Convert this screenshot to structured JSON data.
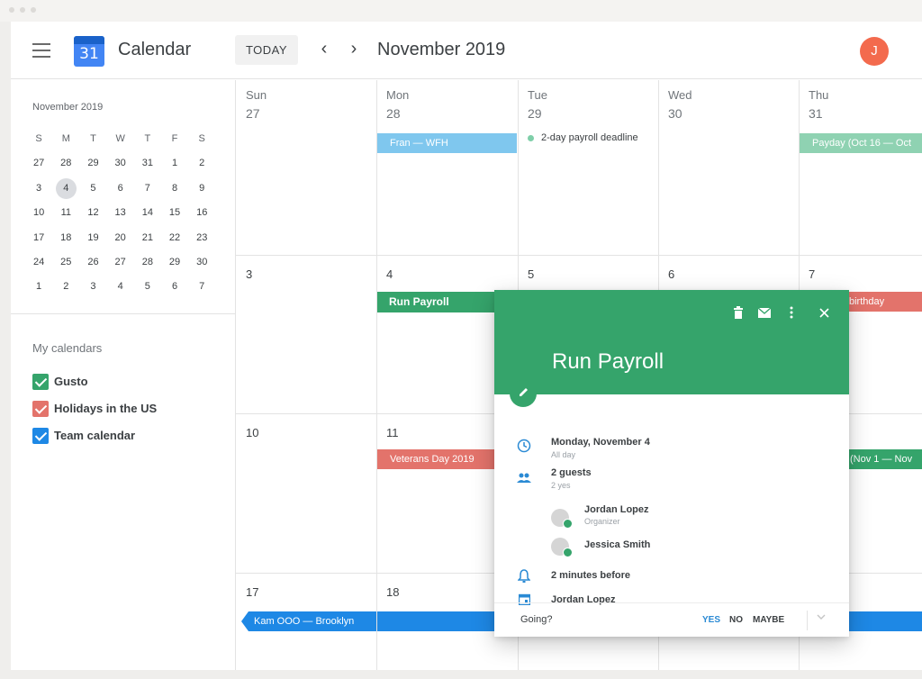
{
  "header": {
    "app_title": "Calendar",
    "logo_day": "31",
    "today_label": "TODAY",
    "prev_arrow": "‹",
    "next_arrow": "›",
    "month_title": "November 2019",
    "avatar_initial": "J",
    "avatar_color": "#f36a4d"
  },
  "mini_calendar": {
    "title": "November 2019",
    "weekdays": [
      "S",
      "M",
      "T",
      "W",
      "T",
      "F",
      "S"
    ],
    "weeks": [
      [
        "27",
        "28",
        "29",
        "30",
        "31",
        "1",
        "2"
      ],
      [
        "3",
        "4",
        "5",
        "6",
        "7",
        "8",
        "9"
      ],
      [
        "10",
        "11",
        "12",
        "13",
        "14",
        "15",
        "16"
      ],
      [
        "17",
        "18",
        "19",
        "20",
        "21",
        "22",
        "23"
      ],
      [
        "24",
        "25",
        "26",
        "27",
        "28",
        "29",
        "30"
      ],
      [
        "1",
        "2",
        "3",
        "4",
        "5",
        "6",
        "7"
      ]
    ],
    "selected": "4"
  },
  "my_calendars": {
    "title": "My calendars",
    "items": [
      {
        "label": "Gusto",
        "color": "#35a46b"
      },
      {
        "label": "Holidays in the US",
        "color": "#e3736b"
      },
      {
        "label": "Team calendar",
        "color": "#1e88e5"
      }
    ]
  },
  "month_view": {
    "weekdays": [
      "Sun",
      "Mon",
      "Tue",
      "Wed",
      "Thu"
    ],
    "header_dates": [
      "27",
      "28",
      "29",
      "30",
      "31"
    ],
    "rows": [
      [
        "3",
        "4",
        "5",
        "6",
        "7"
      ],
      [
        "10",
        "11",
        "",
        "",
        ""
      ],
      [
        "17",
        "18",
        "",
        "",
        ""
      ]
    ]
  },
  "events": {
    "fran_wfh": "Fran — WFH",
    "payroll_deadline": "2-day payroll deadline",
    "payday": "Payday (Oct 16 — Oct",
    "run_payroll": "Run Payroll",
    "birthday": "birthday",
    "veterans_day": "Veterans Day 2019",
    "nov_range": "(Nov 1 — Nov",
    "kam_ooo": "Kam OOO — Brooklyn"
  },
  "popup": {
    "title": "Run Payroll",
    "date": "Monday, November 4",
    "date_sub": "All day",
    "guests": "2 guests",
    "guests_sub": "2 yes",
    "guest_list": [
      {
        "name": "Jordan Lopez",
        "role": "Organizer"
      },
      {
        "name": "Jessica Smith",
        "role": ""
      }
    ],
    "reminder": "2 minutes before",
    "calendar_owner": "Jordan Lopez",
    "going_label": "Going?",
    "yes": "YES",
    "no": "NO",
    "maybe": "MAYBE",
    "header_color": "#35a46b"
  },
  "colors": {
    "gusto_green": "#35a46b",
    "holiday_red": "#e3736b",
    "team_blue": "#1e88e5",
    "wfh_light_blue": "#7fc7ee",
    "payday_mint": "#8fd2b2"
  }
}
